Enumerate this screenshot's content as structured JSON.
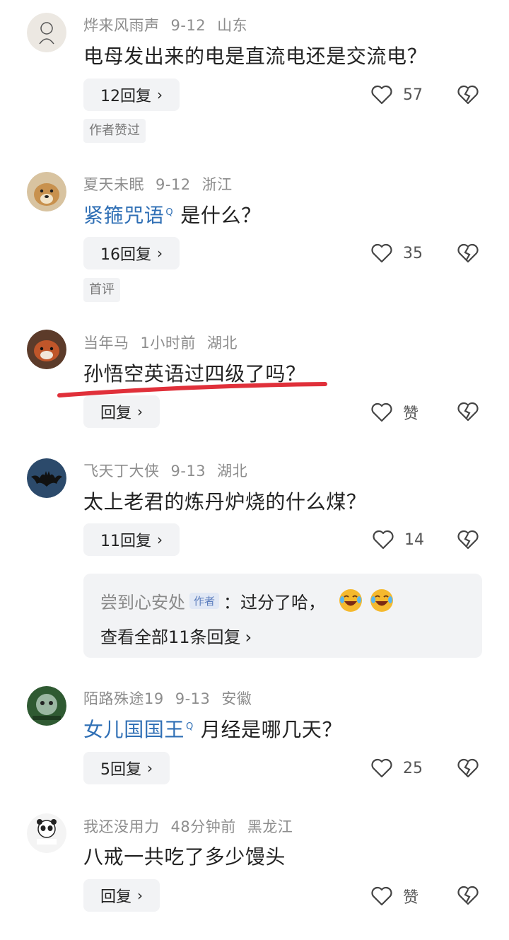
{
  "comments": [
    {
      "user": "烨来风雨声",
      "date": "9-12",
      "location": "山东",
      "text": "电母发出来的电是直流电还是交流电？",
      "reply_label": "12回复",
      "likes": "57",
      "tag": "作者赞过"
    },
    {
      "user": "夏天未眠",
      "date": "9-12",
      "location": "浙江",
      "link": "紧箍咒语",
      "text": "是什么？",
      "reply_label": "16回复",
      "likes": "35",
      "tag": "首评"
    },
    {
      "user": "当年马",
      "date": "1小时前",
      "location": "湖北",
      "text": "孙悟空英语过四级了吗？",
      "reply_label": "回复",
      "likes": "赞"
    },
    {
      "user": "飞天丁大侠",
      "date": "9-13",
      "location": "湖北",
      "text": "太上老君的炼丹炉烧的什么煤？",
      "reply_label": "11回复",
      "likes": "14",
      "sub_reply": {
        "user": "尝到心安处",
        "badge": "作者",
        "text": "：过分了哈，",
        "view_all": "查看全部11条回复"
      }
    },
    {
      "user": "陌路殊途19",
      "date": "9-13",
      "location": "安徽",
      "link": "女儿国国王",
      "text": "月经是哪几天？",
      "reply_label": "5回复",
      "likes": "25"
    },
    {
      "user": "我还没用力",
      "date": "48分钟前",
      "location": "黑龙江",
      "text": "八戒一共吃了多少馒头",
      "reply_label": "回复",
      "likes": "赞"
    }
  ],
  "icons": {
    "chevron": "›",
    "search_mark": "Q"
  },
  "colors": {
    "link": "#2f6fb5",
    "underline": "#e0303a",
    "meta": "#8d8d8d",
    "button_bg": "#f2f3f5"
  }
}
